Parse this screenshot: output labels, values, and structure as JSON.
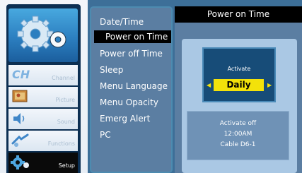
{
  "sidebar": {
    "items": [
      {
        "label": "Channel",
        "icon": "channel-icon"
      },
      {
        "label": "Picture",
        "icon": "picture-icon"
      },
      {
        "label": "Sound",
        "icon": "sound-icon"
      },
      {
        "label": "Functions",
        "icon": "functions-icon"
      },
      {
        "label": "Setup",
        "icon": "setup-gear-icon",
        "active": true
      }
    ],
    "channel_badge": "CH"
  },
  "menu": {
    "items": [
      {
        "label": "Date/Time"
      },
      {
        "label": "Power on Time",
        "selected": true
      },
      {
        "label": "Power off Time"
      },
      {
        "label": "Sleep"
      },
      {
        "label": "Menu Language"
      },
      {
        "label": "Menu Opacity"
      },
      {
        "label": "Emerg Alert"
      },
      {
        "label": "PC"
      }
    ]
  },
  "panel": {
    "title": "Power on Time",
    "activate": {
      "label": "Activate",
      "value": "Daily"
    },
    "info": {
      "line1": "Activate off",
      "line2": "12:00AM",
      "line3": "Cable D6-1"
    }
  },
  "colors": {
    "accent_yellow": "#f3e20a",
    "selected_bg": "#000000",
    "panel_blue": "#5b7ea2"
  }
}
